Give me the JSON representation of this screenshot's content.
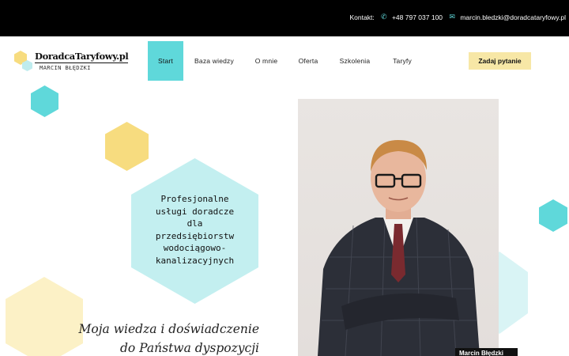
{
  "topbar": {
    "contact_label": "Kontakt:",
    "phone_icon": "phone-icon",
    "phone": "+48 797 037 100",
    "mail_icon": "mail-icon",
    "email": "marcin.bledzki@doradcataryfowy.pl"
  },
  "logo": {
    "brand": "DoradcaTaryfowy.pl",
    "subtitle": "MARCIN BŁĘDZKI"
  },
  "nav": {
    "items": [
      {
        "label": "Start",
        "active": true
      },
      {
        "label": "Baza wiedzy",
        "active": false
      },
      {
        "label": "O mnie",
        "active": false
      },
      {
        "label": "Oferta",
        "active": false
      },
      {
        "label": "Szkolenia",
        "active": false
      },
      {
        "label": "Taryfy",
        "active": false
      }
    ]
  },
  "cta": {
    "label": "Zadaj pytanie"
  },
  "hero": {
    "lines": [
      "Profesjonalne",
      "usługi doradcze",
      "dla",
      "przedsiębiorstw",
      "wodociągowo-",
      "kanalizacyjnych"
    ],
    "tagline_1": "Moja wiedza i doświadczenie",
    "tagline_2": "do Państwa dyspozycji"
  },
  "photo": {
    "caption": "Marcin Błędzki"
  },
  "colors": {
    "accent_cyan": "#5fd8da",
    "light_cyan": "#c3eff0",
    "accent_yellow": "#f7dc7f",
    "light_yellow": "#fcf1c6",
    "topbar": "#000000"
  }
}
